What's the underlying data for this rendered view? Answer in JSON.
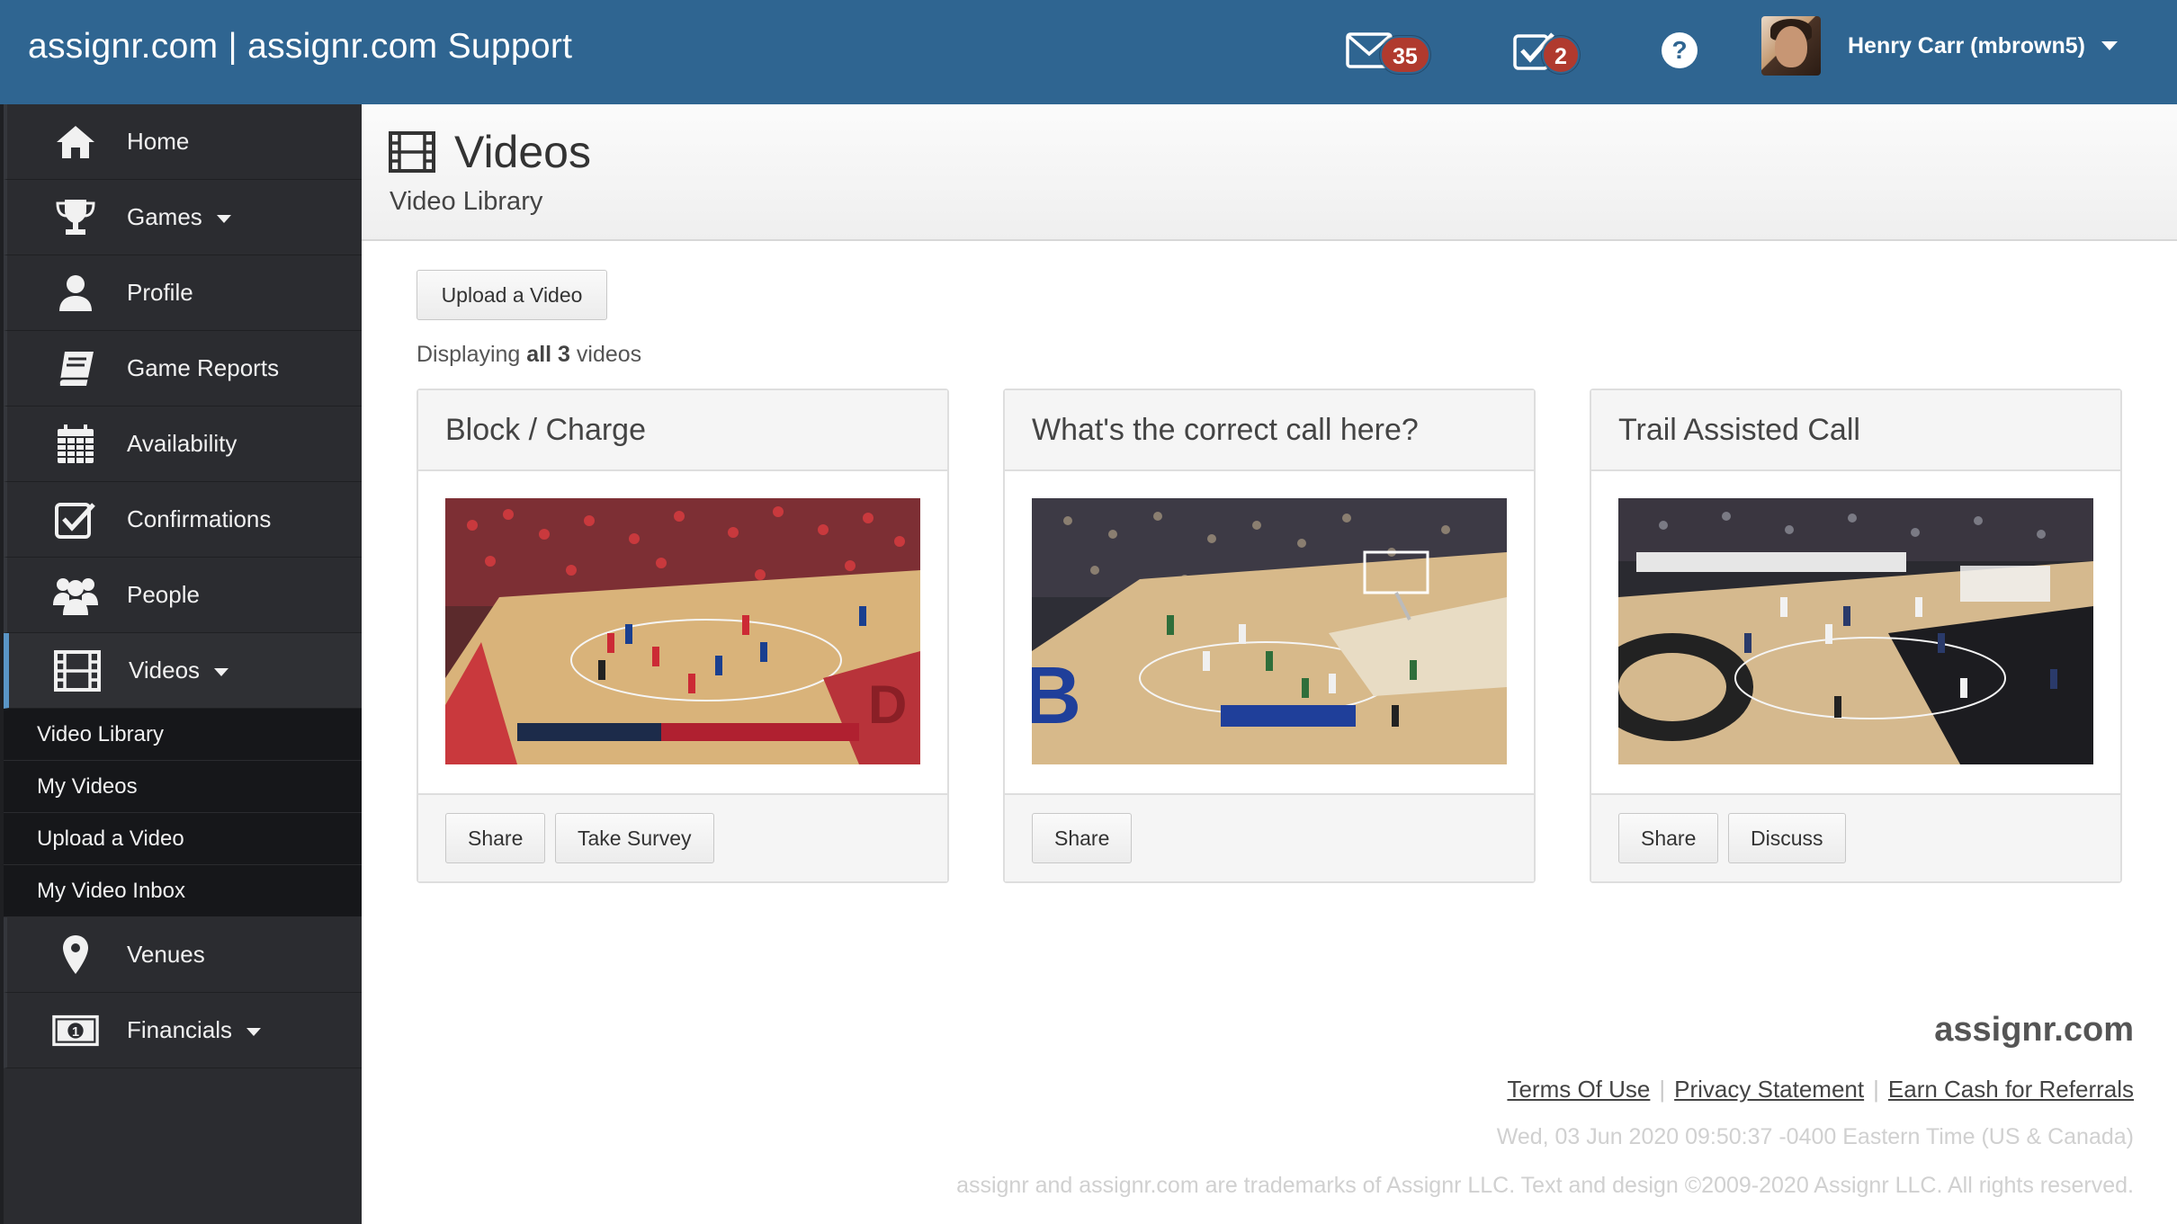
{
  "header": {
    "brand": "assignr.com | assignr.com Support",
    "messages_count": "35",
    "tasks_count": "2",
    "user_name": "Henry Carr (mbrown5)"
  },
  "sidebar": {
    "items": [
      {
        "label": "Home",
        "icon": "home-icon"
      },
      {
        "label": "Games",
        "icon": "trophy-icon",
        "has_caret": true
      },
      {
        "label": "Profile",
        "icon": "user-icon"
      },
      {
        "label": "Game Reports",
        "icon": "book-icon"
      },
      {
        "label": "Availability",
        "icon": "calendar-icon"
      },
      {
        "label": "Confirmations",
        "icon": "checkbox-icon"
      },
      {
        "label": "People",
        "icon": "people-icon"
      },
      {
        "label": "Videos",
        "icon": "film-icon",
        "has_caret": true,
        "active": true
      }
    ],
    "sub_items": [
      "Video Library",
      "My Videos",
      "Upload a Video",
      "My Video Inbox"
    ],
    "items_after": [
      {
        "label": "Venues",
        "icon": "map-marker-icon"
      },
      {
        "label": "Financials",
        "icon": "money-icon",
        "has_caret": true
      }
    ]
  },
  "page": {
    "title": "Videos",
    "subtitle": "Video Library",
    "upload_button": "Upload a Video",
    "displaying_prefix": "Displaying",
    "displaying_bold": "all 3",
    "displaying_suffix": "videos"
  },
  "videos": [
    {
      "title": "Block / Charge",
      "buttons": [
        "Share",
        "Take Survey"
      ]
    },
    {
      "title": "What's the correct call here?",
      "buttons": [
        "Share"
      ]
    },
    {
      "title": "Trail Assisted Call",
      "buttons": [
        "Share",
        "Discuss"
      ]
    }
  ],
  "footer": {
    "brand": "assignr.com",
    "links": [
      "Terms Of Use",
      "Privacy Statement",
      "Earn Cash for Referrals"
    ],
    "timestamp": "Wed, 03 Jun 2020 09:50:37 -0400 Eastern Time (US & Canada)",
    "copyright": "assignr and assignr.com are trademarks of Assignr LLC. Text and design ©2009-2020 Assignr LLC. All rights reserved."
  },
  "colors": {
    "topbar": "#2f6591",
    "sidebar": "#2b2c30",
    "badge": "#b03a2e",
    "active_accent": "#5a95c6"
  }
}
